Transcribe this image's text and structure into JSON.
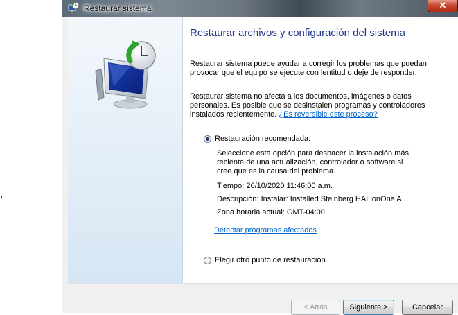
{
  "window": {
    "title": "Restaurar sistema",
    "close_label": "✕"
  },
  "content": {
    "heading": "Restaurar archivos y configuración del sistema",
    "intro": "Restaurar sistema puede ayudar a corregir los problemas que puedan provocar que el equipo se ejecute con lentitud o deje de responder.",
    "notice": "Restaurar sistema no afecta a los documentos, imágenes o datos personales. Es posible que se desinstalen programas y controladores instalados recientemente.",
    "notice_link": "¿Es reversible este proceso?",
    "option_recommended": {
      "label": "Restauración recomendada:",
      "selected": true,
      "description": "Seleccione esta opción para deshacer la instalación más reciente de una actualización, controlador o software si cree que es la causa del problema.",
      "time": "Tiempo: 26/10/2020 11:46:00 a.m.",
      "description_line": "Descripción: Instalar: Installed Steinberg HALionOne A...",
      "timezone": "Zona horaria actual: GMT-04:00",
      "detect_link": "Detectar programas afectados"
    },
    "option_other": {
      "label": "Elegir otro punto de restauración",
      "selected": false
    }
  },
  "buttons": {
    "back": "< Atrás",
    "next": "Siguiente >",
    "cancel": "Cancelar"
  },
  "colors": {
    "heading": "#1e3287",
    "link": "#0066cc"
  },
  "icons": {
    "app": "system-restore-icon",
    "illustration": "monitor-clock-restore-icon"
  }
}
